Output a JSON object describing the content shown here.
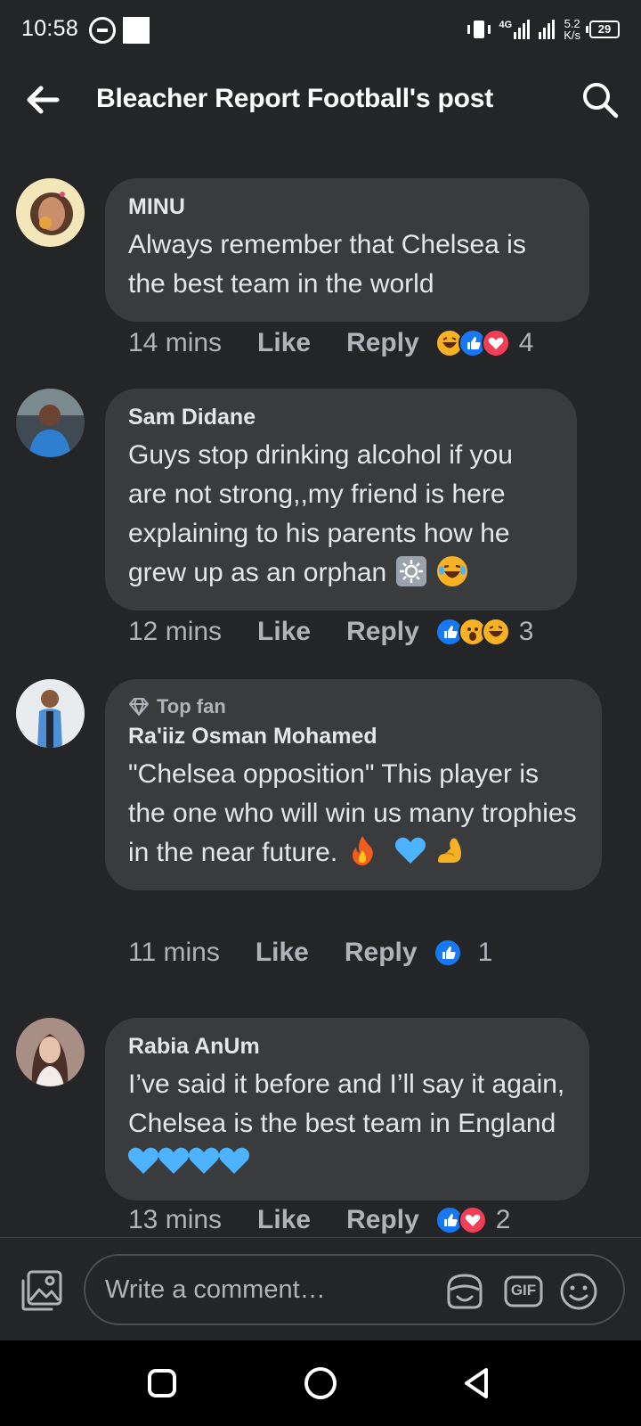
{
  "status_bar": {
    "time": "10:58",
    "network": "4G",
    "speed_value": "5.2",
    "speed_unit": "K/s",
    "battery": "29"
  },
  "header": {
    "title": "Bleacher Report Football's post",
    "back_icon": "arrow-left-icon",
    "search_icon": "search-icon"
  },
  "comments": [
    {
      "author": "MINU",
      "badge": "",
      "text": "Always remember that Chelsea is the best team in the world",
      "time": "14 mins",
      "like": "Like",
      "reply": "Reply",
      "reactions": [
        "haha",
        "like",
        "love"
      ],
      "reaction_count": "4"
    },
    {
      "author": "Sam Didane",
      "badge": "",
      "text": "Guys stop drinking alcohol if you are not strong,,my friend is here explaining to his parents how he grew up as an orphan",
      "time": "12 mins",
      "like": "Like",
      "reply": "Reply",
      "reactions": [
        "like",
        "wow",
        "haha"
      ],
      "reaction_count": "3"
    },
    {
      "author": "Ra'iiz Osman Mohamed",
      "badge": "Top fan",
      "text": "\"Chelsea opposition\" This player is the one who will win us many trophies in the near future.",
      "time": "11 mins",
      "like": "Like",
      "reply": "Reply",
      "reactions": [
        "like"
      ],
      "reaction_count": "1"
    },
    {
      "author": "Rabia AnUm",
      "badge": "",
      "text": "I’ve said it before and I’ll say it again, Chelsea is the best team in England",
      "time": "13 mins",
      "like": "Like",
      "reply": "Reply",
      "reactions": [
        "like",
        "love"
      ],
      "reaction_count": "2"
    }
  ],
  "composer": {
    "placeholder": "Write a comment…",
    "gif_label": "GIF"
  },
  "colors": {
    "background": "#242526",
    "bubble": "#3a3b3c",
    "like_blue": "#1877f2",
    "love_red": "#f33e58",
    "heart_blue": "#4db3ff"
  }
}
